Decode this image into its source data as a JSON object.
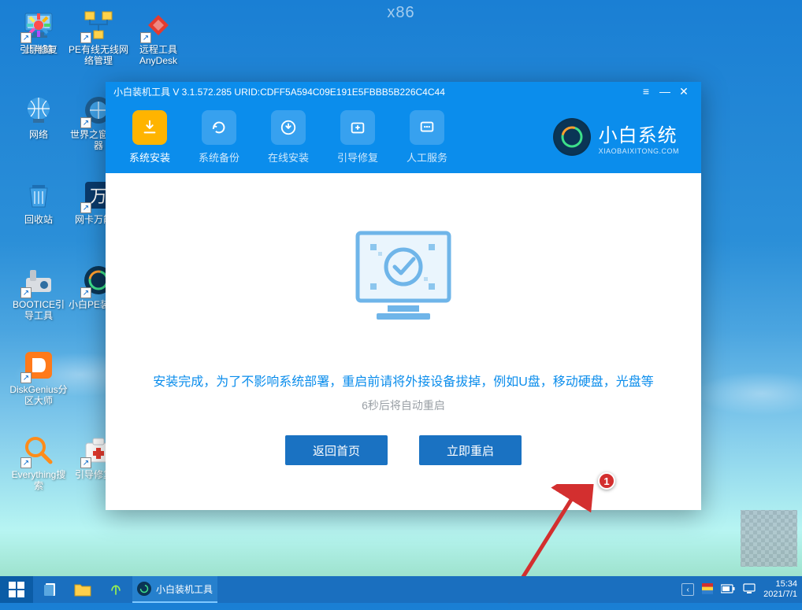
{
  "watermark": "x86",
  "desktop": [
    {
      "name": "this-pc",
      "label": "此电脑",
      "icon": "pc"
    },
    {
      "name": "pe-net-mgr",
      "label": "PE有线无线网络管理",
      "icon": "network",
      "shortcut": true
    },
    {
      "name": "anydesk",
      "label": "远程工具AnyDesk",
      "icon": "anydesk",
      "shortcut": true
    },
    {
      "name": "network",
      "label": "网络",
      "icon": "globe"
    },
    {
      "name": "world-browser",
      "label": "世界之窗浏览器",
      "icon": "browser",
      "shortcut": true
    },
    {
      "name": "recycle-bin",
      "label": "回收站",
      "icon": "trash"
    },
    {
      "name": "netcard-driver",
      "label": "网卡万能驱",
      "icon": "wan",
      "shortcut": true
    },
    {
      "name": "bootice",
      "label": "BOOTICE引导工具",
      "icon": "bootice",
      "shortcut": true
    },
    {
      "name": "xiaobai-pe",
      "label": "小白PE装机具",
      "icon": "xiaobai",
      "shortcut": true
    },
    {
      "name": "diskgenius",
      "label": "DiskGenius分区大师",
      "icon": "diskgenius",
      "shortcut": true
    },
    {
      "name": "boot-repair",
      "label": "引导修复",
      "icon": "bootrepair",
      "shortcut": true
    },
    {
      "name": "everything",
      "label": "Everything搜索",
      "icon": "search",
      "shortcut": true
    },
    {
      "name": "boot-repair-tool",
      "label": "引导修复工",
      "icon": "firstaid",
      "shortcut": true
    }
  ],
  "app": {
    "title": "小白装机工具 V 3.1.572.285 URID:CDFF5A594C09E191E5FBBB5B226C4C44",
    "tabs": [
      {
        "id": "install",
        "label": "系统安装",
        "active": true
      },
      {
        "id": "backup",
        "label": "系统备份"
      },
      {
        "id": "online",
        "label": "在线安装"
      },
      {
        "id": "bootfix",
        "label": "引导修复"
      },
      {
        "id": "support",
        "label": "人工服务"
      }
    ],
    "brand": {
      "main": "小白系统",
      "sub": "XIAOBAIXITONG.COM"
    },
    "message": "安装完成，为了不影响系统部署，重启前请将外接设备拔掉，例如U盘，移动硬盘，光盘等",
    "countdown": "6秒后将自动重启",
    "buttons": {
      "back": "返回首页",
      "restart": "立即重启"
    },
    "badge": "1"
  },
  "taskbar": {
    "app_label": "小白装机工具",
    "time": "15:34",
    "date": "2021/7/1"
  }
}
